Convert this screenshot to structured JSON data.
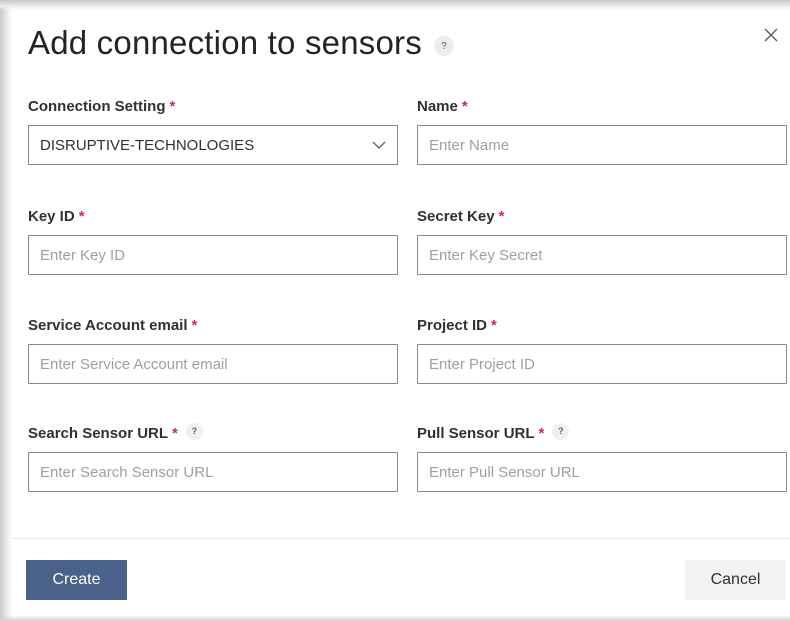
{
  "dialog": {
    "title": "Add connection to sensors",
    "help_glyph": "?",
    "close_icon": "close-icon"
  },
  "fields": {
    "connection_setting": {
      "label": "Connection Setting",
      "required_mark": "*",
      "value": "DISRUPTIVE-TECHNOLOGIES",
      "icon": "chevron-down-icon"
    },
    "name": {
      "label": "Name",
      "required_mark": "*",
      "placeholder": "Enter Name"
    },
    "key_id": {
      "label": "Key ID",
      "required_mark": "*",
      "placeholder": "Enter Key ID"
    },
    "secret_key": {
      "label": "Secret Key",
      "required_mark": "*",
      "placeholder": "Enter Key Secret"
    },
    "service_account_email": {
      "label": "Service Account email",
      "required_mark": "*",
      "placeholder": "Enter Service Account email"
    },
    "project_id": {
      "label": "Project ID",
      "required_mark": "*",
      "placeholder": "Enter Project ID"
    },
    "search_sensor_url": {
      "label": "Search Sensor URL",
      "required_mark": "*",
      "help_glyph": "?",
      "placeholder": "Enter Search Sensor URL"
    },
    "pull_sensor_url": {
      "label": "Pull Sensor URL",
      "required_mark": "*",
      "help_glyph": "?",
      "placeholder": "Enter Pull Sensor URL"
    }
  },
  "footer": {
    "create_label": "Create",
    "cancel_label": "Cancel"
  },
  "colors": {
    "primary_button": "#4a6289",
    "required_mark": "#c4314b",
    "input_border": "#8a8886",
    "secondary_button": "#f3f2f1"
  }
}
